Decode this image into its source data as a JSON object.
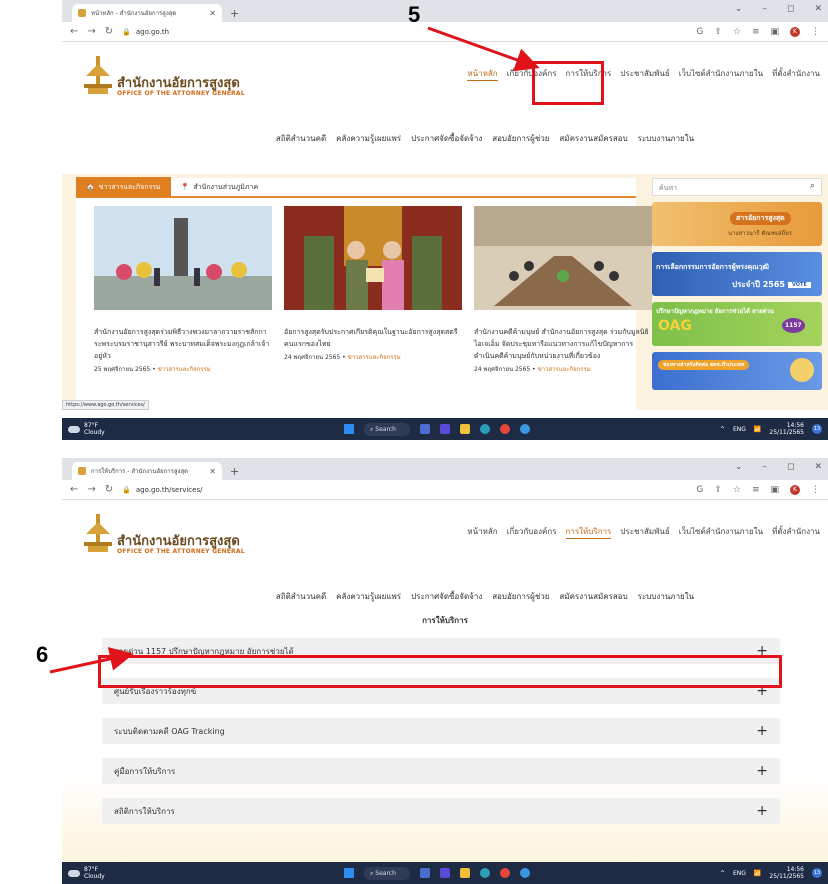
{
  "annotations": {
    "step5": "5",
    "step6": "6"
  },
  "shot1": {
    "tab_title": "หน้าหลัก - สำนักงานอัยการสูงสุด",
    "url": "ago.go.th",
    "status_url": "https://www.ago.go.th/services/",
    "news_tabs": [
      "ข่าวสารและกิจกรรม",
      "สำนักงานส่วนภูมิภาค"
    ],
    "search_placeholder": "ค้นหา",
    "news": [
      {
        "title": "สำนักงานอัยการสูงสุดร่วมพิธีวางพวงมาลาถวายราชสักการะพระบรมราชานุสาวรีย์ พระบาทสมเด็จพระมงกุฎเกล้าเจ้าอยู่หัว",
        "date": "25 พฤศจิกายน 2565",
        "category": "ข่าวสารและกิจกรรม"
      },
      {
        "title": "อัยการสูงสุดรับประกาศเกียรติคุณในฐานะอัยการสูงสุดสตรีคนแรกของไทย",
        "date": "24 พฤศจิกายน 2565",
        "category": "ข่าวสารและกิจกรรม"
      },
      {
        "title": "สำนักงานคดีค้ามนุษย์ สำนักงานอัยการสูงสุด ร่วมกับมูลนิธิไอเจเอ็ม จัดประชุมหารือแนวทางการแก้ไขปัญหาการดำเนินคดีค้ามนุษย์กับหน่วยงานที่เกี่ยวข้อง",
        "date": "24 พฤศจิกายน 2565",
        "category": "ข่าวสารและกิจกรรม"
      }
    ],
    "banners": [
      {
        "text": "สารอัยการสูงสุด",
        "sub": "นางสาวนารี ตัณฑเสถียร"
      },
      {
        "text": "การเลือกกรรมการอัยการผู้ทรงคุณวุฒิ",
        "sub": "ประจำปี 2565",
        "tag": "VOTE"
      },
      {
        "text": "ปรึกษาปัญหากฎหมาย อัยการช่วยได้ สายด่วน",
        "sub": "OAG",
        "tag": "1157"
      },
      {
        "text": "ช่องทางสำหรับติดต่อ สคช.ทั่วประเทศ",
        "sub": ""
      }
    ]
  },
  "shot2": {
    "tab_title": "การให้บริการ - สำนักงานอัยการสูงสุด",
    "url": "ago.go.th/services/",
    "section_title": "การให้บริการ",
    "services": [
      "สายด่วน 1157 ปรึกษาปัญหากฎหมาย อัยการช่วยได้",
      "ศูนย์รับเรื่องราวร้องทุกข์",
      "ระบบติดตามคดี OAG Tracking",
      "คู่มือการให้บริการ",
      "สถิติการให้บริการ"
    ]
  },
  "site": {
    "name_th": "สำนักงานอัยการสูงสุด",
    "name_en": "OFFICE OF THE ATTORNEY GENERAL",
    "top_nav": [
      "หน้าหลัก",
      "เกี่ยวกับองค์กร",
      "การให้บริการ",
      "ประชาสัมพันธ์",
      "เว็บไซต์สำนักงานภายใน",
      "ที่ตั้งสำนักงาน"
    ],
    "sub_nav": [
      "สถิติสำนวนคดี",
      "คลังความรู้เผยแพร่",
      "ประกาศจัดซื้อจัดจ้าง",
      "สอบอัยการผู้ช่วย",
      "สมัครงานสมัครสอบ",
      "ระบบงานภายใน"
    ]
  },
  "taskbar": {
    "temp": "87°F",
    "weather": "Cloudy",
    "search": "Search",
    "lang": "ENG",
    "time": "14:56",
    "date": "25/11/2565",
    "badge": "13"
  },
  "colors": {
    "accent": "#c26b1b",
    "annotation_red": "#e0131b",
    "taskbar": "#1d2b45"
  }
}
